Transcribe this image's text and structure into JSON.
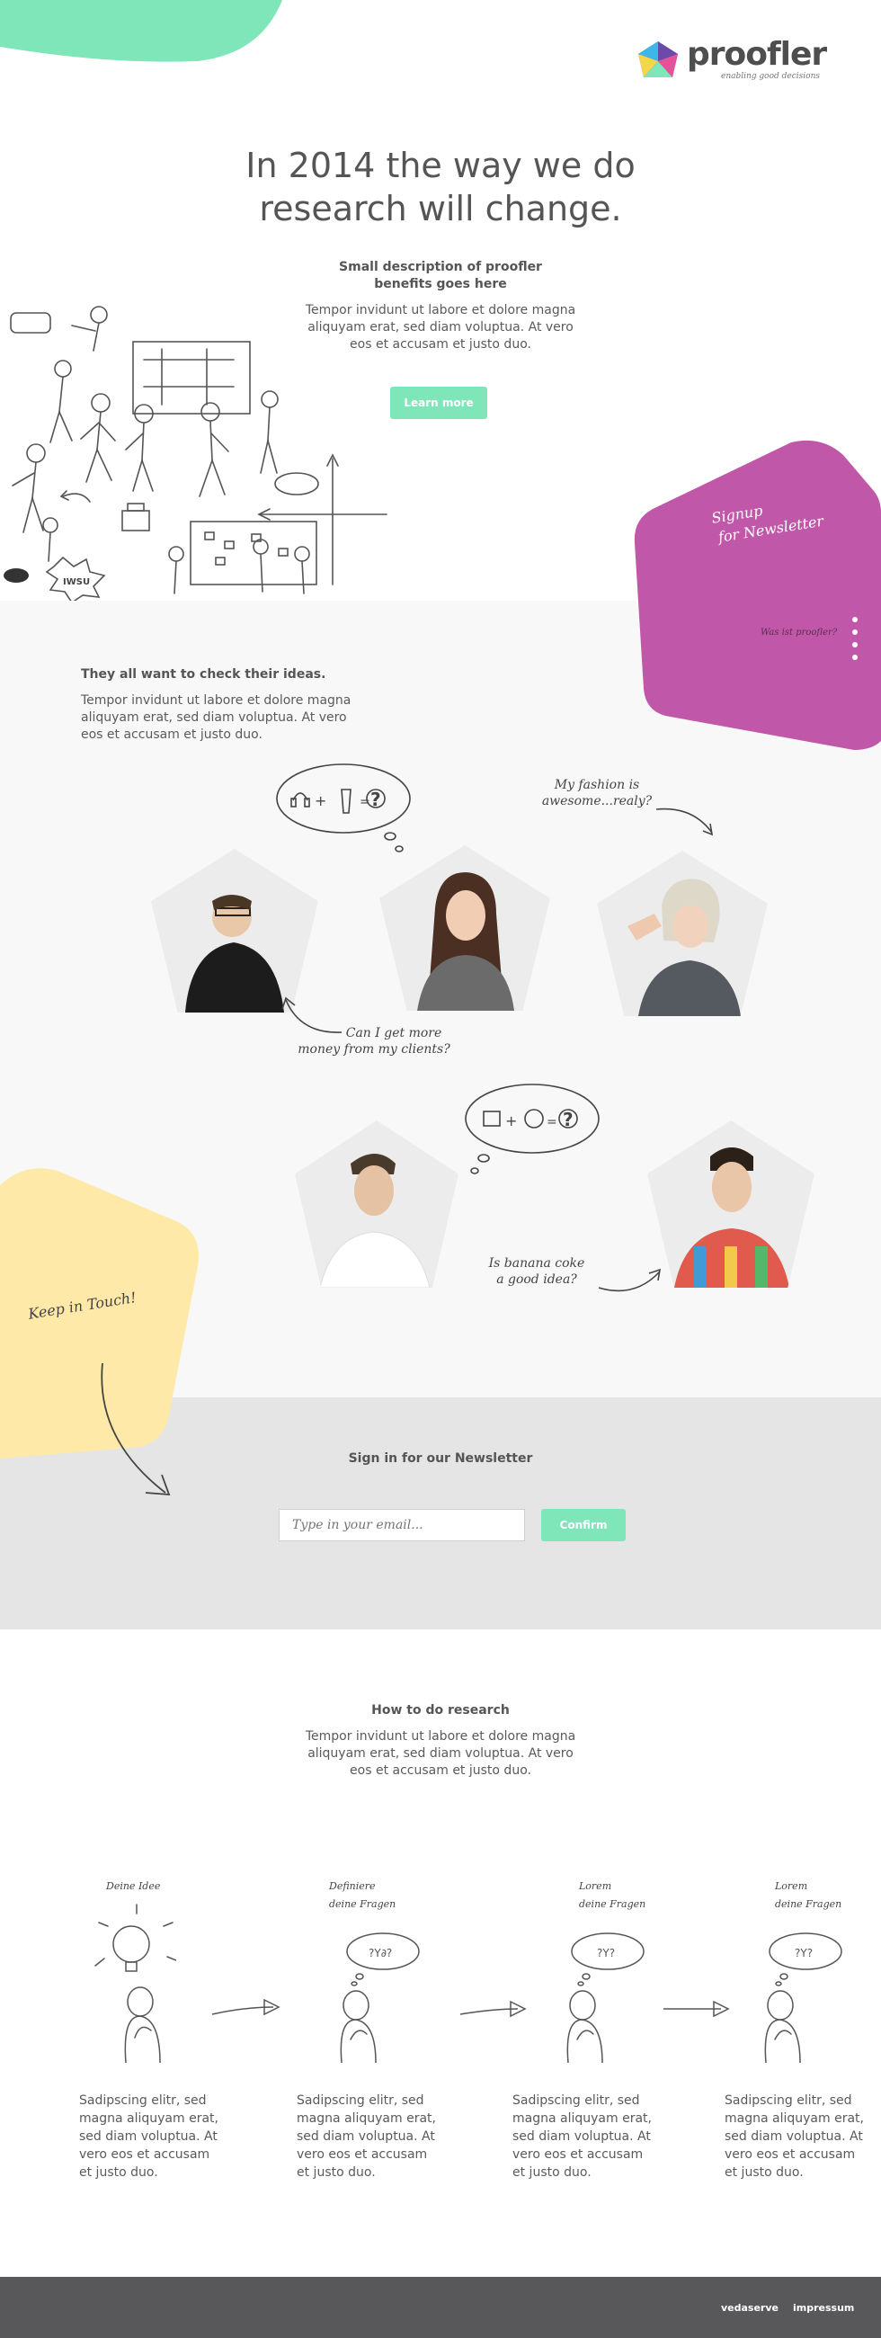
{
  "header": {
    "logo_text": "proofler",
    "logo_tagline": "enabling good decisions"
  },
  "hero": {
    "title_line1": "In 2014 the way we do",
    "title_line2": "research will change.",
    "subtitle_line1": "Small description of proofler",
    "subtitle_line2": "benefits goes here",
    "body_line1": "Tempor invidunt ut labore et dolore magna",
    "body_line2": "aliquyam erat, sed diam voluptua. At vero",
    "body_line3": "eos et accusam et justo duo.",
    "cta_label": "Learn more"
  },
  "signup_panel": {
    "line1": "Signup",
    "line2": "for Newsletter",
    "small_text": "Was ist proofler?"
  },
  "ideas": {
    "heading": "They all want to check their ideas.",
    "body_line1": "Tempor invidunt ut labore et dolore magna",
    "body_line2": "aliquyam erat, sed diam voluptua. At vero",
    "body_line3": "eos et accusam et justo duo.",
    "quote_fashion_1": "My fashion is",
    "quote_fashion_2": "awesome...realy?",
    "quote_money_1": "Can I get more",
    "quote_money_2": "money from my clients?",
    "quote_banana_1": "Is banana coke",
    "quote_banana_2": "a good idea?"
  },
  "keep_in_touch": {
    "label": "Keep in Touch!"
  },
  "newsletter": {
    "heading": "Sign in for our Newsletter",
    "email_placeholder": "Type in your email...",
    "confirm_label": "Confirm"
  },
  "research": {
    "heading": "How to do research",
    "body_line1": "Tempor invidunt ut labore et dolore magna",
    "body_line2": "aliquyam erat, sed diam voluptua. At vero",
    "body_line3": "eos et accusam et justo duo.",
    "steps": [
      {
        "label1": "Deine Idee",
        "label2": "",
        "text": [
          "Sadipscing elitr, sed",
          "magna aliquyam erat,",
          "sed diam voluptua. At",
          "vero eos et accusam",
          "et justo duo."
        ]
      },
      {
        "label1": "Definiere",
        "label2": "deine Fragen",
        "text": [
          "Sadipscing elitr, sed",
          "magna aliquyam erat,",
          "sed diam voluptua. At",
          "vero eos et accusam",
          "et justo duo."
        ]
      },
      {
        "label1": "Lorem",
        "label2": "deine Fragen",
        "text": [
          "Sadipscing elitr, sed",
          "magna aliquyam erat,",
          "sed diam voluptua. At",
          "vero eos et accusam",
          "et justo duo."
        ]
      },
      {
        "label1": "Lorem",
        "label2": "deine Fragen",
        "text": [
          "Sadipscing elitr, sed",
          "magna aliquyam erat,",
          "sed diam voluptua. At",
          "vero eos et accusam",
          "et justo duo."
        ]
      }
    ]
  },
  "footer": {
    "link1": "vedaserve",
    "link2": "impressum"
  },
  "colors": {
    "mint": "#7ee6b8",
    "magenta": "#c157a8",
    "yellow": "#ffe9a8",
    "light_gray": "#f8f8f8",
    "mid_gray": "#e5e5e5",
    "footer_dark": "#58585a"
  }
}
